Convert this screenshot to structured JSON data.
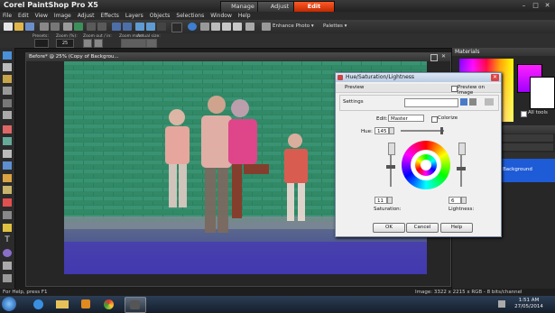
{
  "app": {
    "title": "Corel PaintShop Pro X5",
    "workspace_tabs": [
      "Manage",
      "Adjust",
      "Edit"
    ],
    "active_tab": "Edit"
  },
  "menu": [
    "File",
    "Edit",
    "View",
    "Image",
    "Adjust",
    "Effects",
    "Layers",
    "Objects",
    "Selections",
    "Window",
    "Help"
  ],
  "toolbar": {
    "enhance_photo": "Enhance Photo ▾",
    "palettes": "Palettes ▾"
  },
  "options_bar": {
    "labels": [
      "Presets:",
      "Zoom (%):",
      "Zoom out / in:",
      "Zoom more:",
      "Actual size:"
    ],
    "zoom_value": "25"
  },
  "image_window": {
    "title": "Before* @ 25% (Copy of Backgrou..."
  },
  "materials": {
    "title": "Materials",
    "all_tools": "All tools"
  },
  "layers": {
    "layer_name": "Background"
  },
  "dialog": {
    "title": "Hue/Saturation/Lightness",
    "preview": "Preview",
    "preview_on_image": "Preview on Image",
    "settings_label": "Settings",
    "edit_label": "Edit:",
    "edit_value": "Master",
    "colorize": "Colorize",
    "hue_label": "Hue:",
    "hue_value": "145",
    "saturation_label": "Saturation:",
    "saturation_value": "11",
    "lightness_label": "Lightness:",
    "lightness_value": "6",
    "ok": "OK",
    "cancel": "Cancel",
    "help": "Help"
  },
  "status": {
    "left": "For Help, press F1",
    "right": "Image: 3322 x 2215 x RGB - 8 bits/channel"
  },
  "taskbar": {
    "time": "1:51 AM",
    "date": "27/05/2014"
  },
  "colors": {
    "accent": "#e8451a",
    "panel": "#2a2a2a",
    "dialog": "#f0f0f0"
  }
}
